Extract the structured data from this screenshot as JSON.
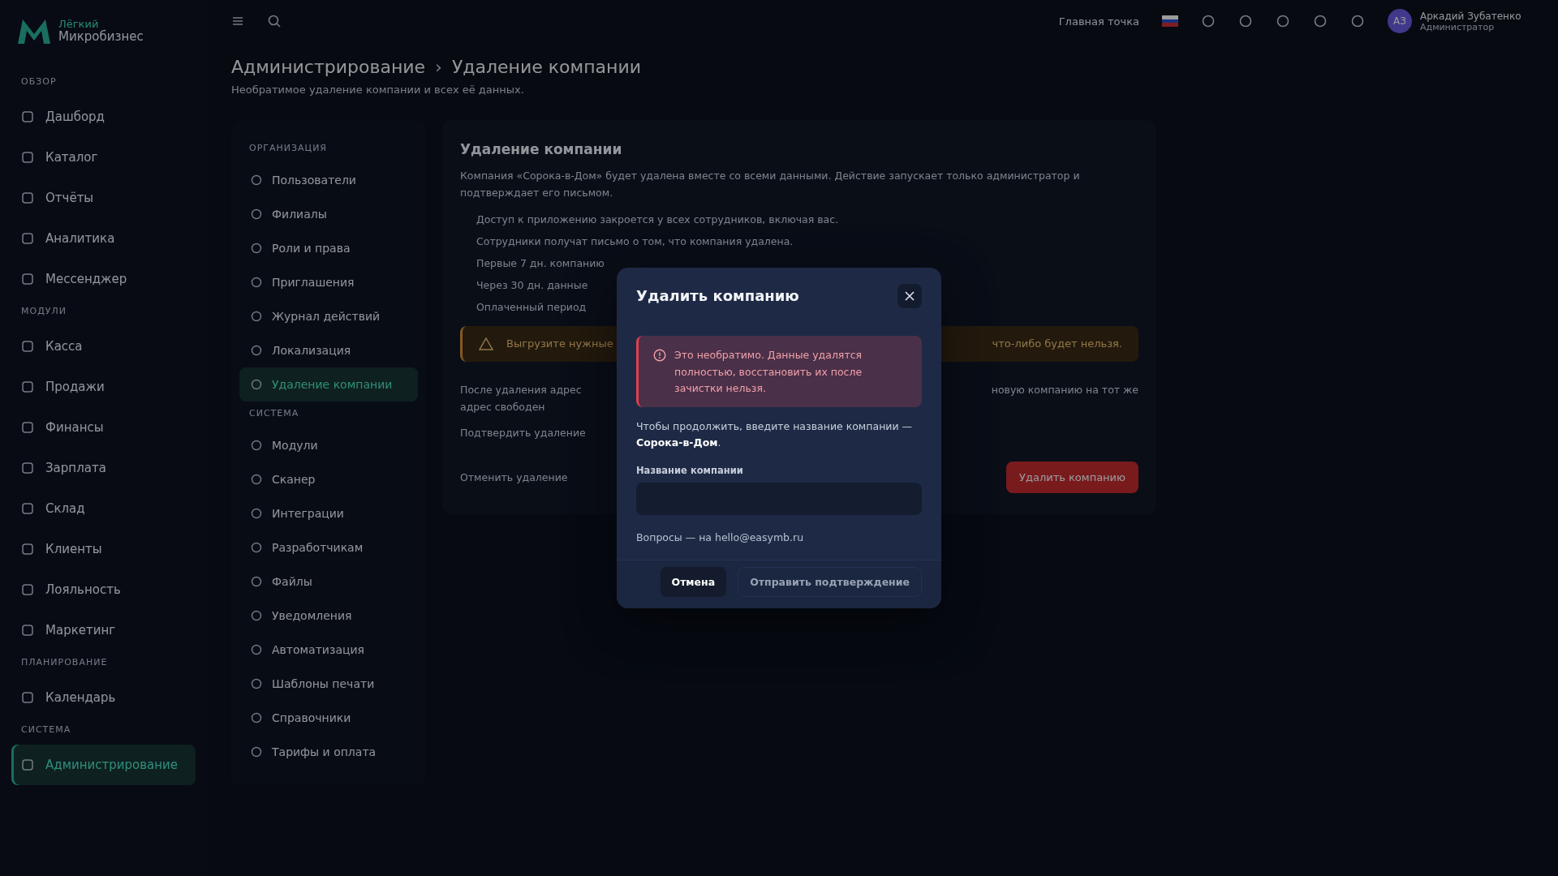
{
  "app": {
    "logo_top": "Лёгкий",
    "logo_bottom": "Микробизнес"
  },
  "sidebar": {
    "sections": [
      {
        "title": "ОБЗОР",
        "items": [
          {
            "label": "Дашборд",
            "selected": false
          },
          {
            "label": "Каталог",
            "selected": false
          },
          {
            "label": "Отчёты",
            "selected": false
          },
          {
            "label": "Аналитика",
            "selected": false
          },
          {
            "label": "Мессенджер",
            "selected": false
          }
        ]
      },
      {
        "title": "МОДУЛИ",
        "items": [
          {
            "label": "Касса",
            "selected": false
          },
          {
            "label": "Продажи",
            "selected": false
          },
          {
            "label": "Финансы",
            "selected": false
          },
          {
            "label": "Зарплата",
            "selected": false
          },
          {
            "label": "Склад",
            "selected": false
          },
          {
            "label": "Клиенты",
            "selected": false
          },
          {
            "label": "Лояльность",
            "selected": false
          },
          {
            "label": "Маркетинг",
            "selected": false
          }
        ]
      },
      {
        "title": "ПЛАНИРОВАНИЕ",
        "items": [
          {
            "label": "Календарь",
            "selected": false
          }
        ]
      },
      {
        "title": "СИСТЕМА",
        "items": [
          {
            "label": "Администрирование",
            "selected": true
          }
        ]
      }
    ]
  },
  "topbar": {
    "location": "Главная точка",
    "user_name": "Аркадий Зубатенко",
    "user_role": "Администратор",
    "avatar": "АЗ"
  },
  "breadcrumb": [
    "Администрирование",
    "Удаление компании"
  ],
  "breadcrumb_separator": "›",
  "subtitle": "Необратимое удаление компании и всех её данных.",
  "subnav": {
    "sections": [
      {
        "title": "ОРГАНИЗАЦИЯ",
        "items": [
          {
            "label": "Пользователи",
            "selected": false
          },
          {
            "label": "Филиалы",
            "selected": false
          },
          {
            "label": "Роли и права",
            "selected": false
          },
          {
            "label": "Приглашения",
            "selected": false
          },
          {
            "label": "Журнал действий",
            "selected": false
          },
          {
            "label": "Локализация",
            "selected": false
          },
          {
            "label": "Удаление компании",
            "selected": true
          }
        ]
      },
      {
        "title": "СИСТЕМА",
        "items": [
          {
            "label": "Модули",
            "selected": false
          },
          {
            "label": "Сканер",
            "selected": false
          },
          {
            "label": "Интеграции",
            "selected": false
          },
          {
            "label": "Разработчикам",
            "selected": false
          },
          {
            "label": "Файлы",
            "selected": false
          },
          {
            "label": "Уведомления",
            "selected": false
          },
          {
            "label": "Автоматизация",
            "selected": false
          },
          {
            "label": "Шаблоны печати",
            "selected": false
          },
          {
            "label": "Справочники",
            "selected": false
          },
          {
            "label": "Тарифы и оплата",
            "selected": false
          }
        ]
      }
    ]
  },
  "card": {
    "title": "Удаление компании",
    "intro": "Компания «Сорока-в-Дом» будет удалена вместе со всеми данными. Действие запускает только администратор и подтверждает его письмом.",
    "bullets": [
      "Доступ к приложению закроется у всех сотрудников, включая вас.",
      "Сотрудники получат письмо о том, что компания удалена.",
      "Первые 7 дн. компанию",
      "Через 30 дн. данные",
      "Оплаченный период"
    ],
    "warning_left": "Выгрузите нужные",
    "warning_right": "что-либо будет нельзя.",
    "note_left": [
      "После удаления адрес",
      "адрес свободен"
    ],
    "note_right": "новую компанию на тот же",
    "confirm_label": "Подтвердить удаление",
    "cancel_note": "Отменить удаление",
    "delete_button": "Удалить компанию"
  },
  "modal": {
    "title": "Удалить компанию",
    "alert": "Это необратимо. Данные удалятся полностью, восстановить их после зачистки нельзя.",
    "prompt": "Чтобы продолжить, введите название компании — **Сорока-в-Дом**.",
    "field_label": "Название компании",
    "contact": "Вопросы — на hello@easymb.ru",
    "buttons": [
      {
        "label": "Отмена",
        "kind": "secondary"
      },
      {
        "label": "Отправить подтверждение",
        "kind": "outline"
      }
    ]
  }
}
